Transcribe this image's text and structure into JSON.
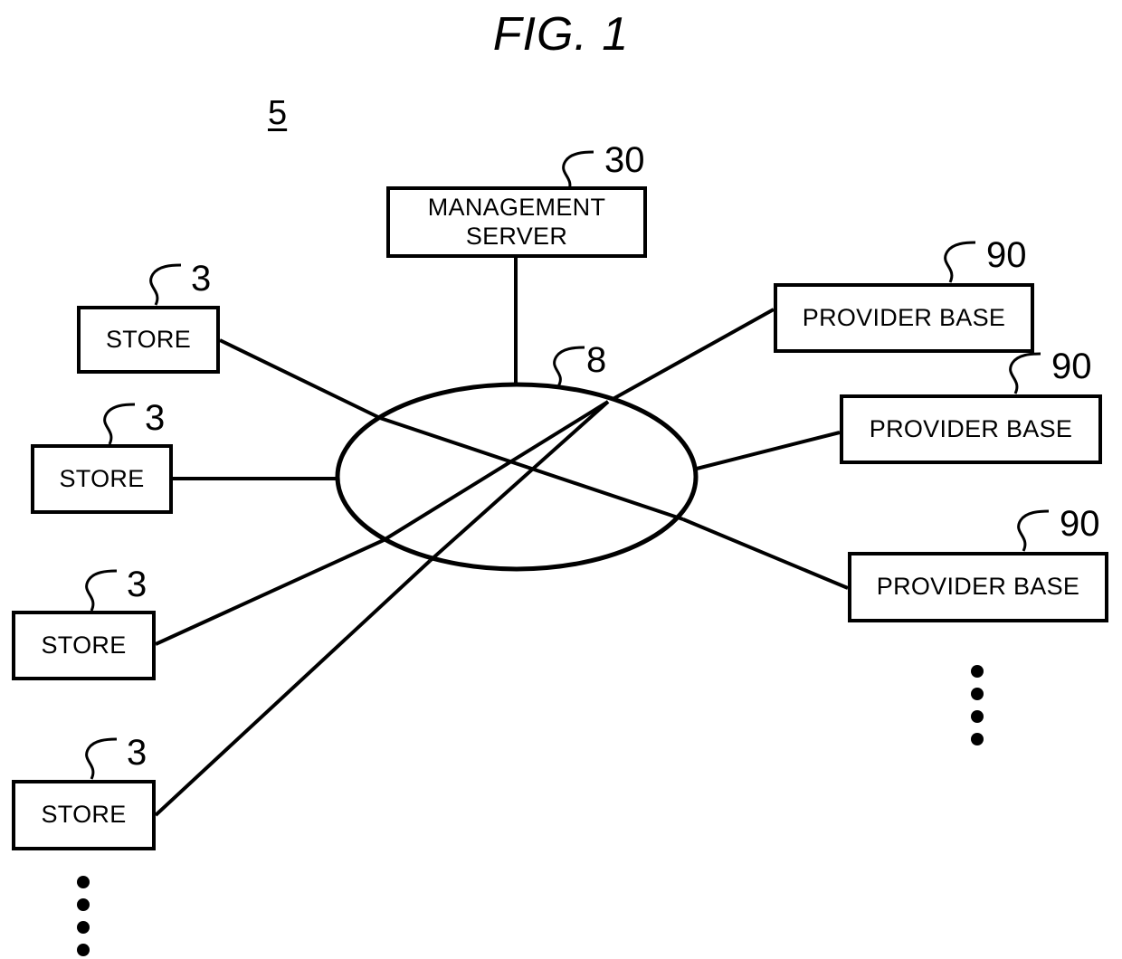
{
  "figure": {
    "title": "FIG. 1",
    "system_ref": "5"
  },
  "nodes": {
    "management_server": {
      "label": "MANAGEMENT\nSERVER",
      "ref": "30"
    },
    "network": {
      "ref": "8",
      "shape": "ellipse"
    },
    "stores": [
      {
        "label": "STORE",
        "ref": "3"
      },
      {
        "label": "STORE",
        "ref": "3"
      },
      {
        "label": "STORE",
        "ref": "3"
      },
      {
        "label": "STORE",
        "ref": "3"
      }
    ],
    "provider_bases": [
      {
        "label": "PROVIDER BASE",
        "ref": "90"
      },
      {
        "label": "PROVIDER BASE",
        "ref": "90"
      },
      {
        "label": "PROVIDER BASE",
        "ref": "90"
      }
    ]
  },
  "continuation": {
    "stores_more": "⋮",
    "providers_more": "⋮"
  },
  "colors": {
    "line": "#000000",
    "background": "#ffffff"
  }
}
